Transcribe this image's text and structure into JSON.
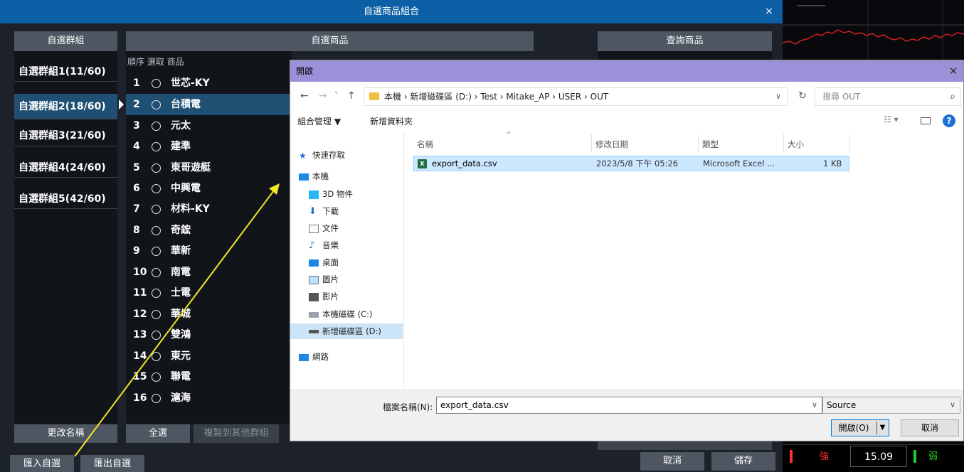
{
  "main_window": {
    "title": "自選商品組合",
    "close_glyph": "×",
    "group_panel_title": "自選群組",
    "stock_panel_title": "自選商品",
    "query_panel_title": "查詢商品",
    "groups": [
      {
        "label": "自選群組1(11/60)"
      },
      {
        "label": "自選群組2(18/60)",
        "selected": true
      },
      {
        "label": "自選群組3(21/60)"
      },
      {
        "label": "自選群組4(24/60)"
      },
      {
        "label": "自選群組5(42/60)"
      }
    ],
    "stock_column_header": "順序 選取 商品",
    "stocks": [
      {
        "no": "1",
        "name": "世芯-KY"
      },
      {
        "no": "2",
        "name": "台積電",
        "selected": true
      },
      {
        "no": "3",
        "name": "元太"
      },
      {
        "no": "4",
        "name": "建準"
      },
      {
        "no": "5",
        "name": "東哥遊艇"
      },
      {
        "no": "6",
        "name": "中興電"
      },
      {
        "no": "7",
        "name": "材料-KY"
      },
      {
        "no": "8",
        "name": "奇鋐"
      },
      {
        "no": "9",
        "name": "華新"
      },
      {
        "no": "10",
        "name": "南電"
      },
      {
        "no": "11",
        "name": "士電"
      },
      {
        "no": "12",
        "name": "華城"
      },
      {
        "no": "13",
        "name": "雙鴻"
      },
      {
        "no": "14",
        "name": "東元"
      },
      {
        "no": "15",
        "name": "聯電"
      },
      {
        "no": "16",
        "name": "滬海"
      }
    ],
    "buttons": {
      "rename": "更改名稱",
      "select_all": "全選",
      "copy_to_group": "複製到其他群組",
      "import": "匯入自選",
      "export": "匯出自選",
      "cancel": "取消",
      "save": "儲存"
    }
  },
  "quote_strip": {
    "left_label": "強",
    "price": "15.09",
    "right_label": "弱"
  },
  "file_dialog": {
    "title": "開啟",
    "close_glyph": "✕",
    "address_parts": "本機 › 新增磁碟區 (D:) › Test › Mitake_AP › USER › OUT",
    "search_placeholder": "搜尋 OUT",
    "toolbar": {
      "organize": "組合管理 ▼",
      "new_folder": "新增資料夾"
    },
    "nav_items": [
      {
        "label": "快速存取",
        "icon": "star-icon"
      },
      {
        "label": "本機",
        "icon": "computer-icon"
      },
      {
        "label": "3D 物件",
        "icon": "cube-icon"
      },
      {
        "label": "下載",
        "icon": "download-icon"
      },
      {
        "label": "文件",
        "icon": "document-icon"
      },
      {
        "label": "音樂",
        "icon": "music-icon"
      },
      {
        "label": "桌面",
        "icon": "desktop-icon"
      },
      {
        "label": "圖片",
        "icon": "picture-icon"
      },
      {
        "label": "影片",
        "icon": "video-icon"
      },
      {
        "label": "本機磁碟 (C:)",
        "icon": "drive-icon"
      },
      {
        "label": "新增磁碟區 (D:)",
        "icon": "drive-icon",
        "selected": true
      },
      {
        "label": "網路",
        "icon": "network-icon"
      }
    ],
    "columns": {
      "name": "名稱",
      "modified": "修改日期",
      "type": "類型",
      "size": "大小"
    },
    "files": [
      {
        "name": "export_data.csv",
        "modified": "2023/5/8 下午 05:26",
        "type": "Microsoft Excel ...",
        "size": "1 KB"
      }
    ],
    "filename_label": "檔案名稱(N):",
    "filename_value": "export_data.csv",
    "filetype_value": "Source",
    "open_label": "開啟(O)",
    "cancel_label": "取消"
  },
  "colors": {
    "title_bar": "#0d5fa6",
    "dialog_title_bar": "#9b91d8",
    "selected_row": "#1f4f73",
    "annotation_arrow": "#f5e629",
    "chart_line": "#d42020",
    "quote_up": "#ff3030",
    "quote_down": "#25d025"
  }
}
